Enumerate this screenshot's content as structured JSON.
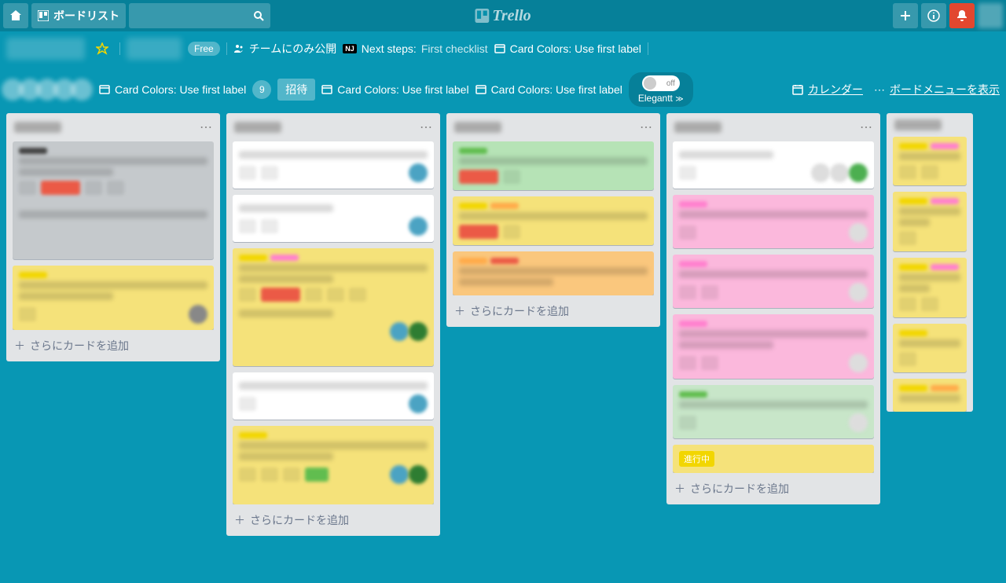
{
  "topbar": {
    "boards_label": "ボードリスト",
    "logo": "Trello"
  },
  "boardbar": {
    "free": "Free",
    "visibility": "チームにのみ公開",
    "next_steps_label": "Next steps:",
    "next_steps_value": "First checklist",
    "card_colors": "Card Colors: Use first label",
    "invite": "招待",
    "count": "9",
    "toggle": "off",
    "elegantt": "Elegantt",
    "calendar": "カレンダー",
    "show_menu": "ボードメニューを表示"
  },
  "lists": {
    "add_card": "さらにカードを追加",
    "progress_badge": "進行中"
  }
}
